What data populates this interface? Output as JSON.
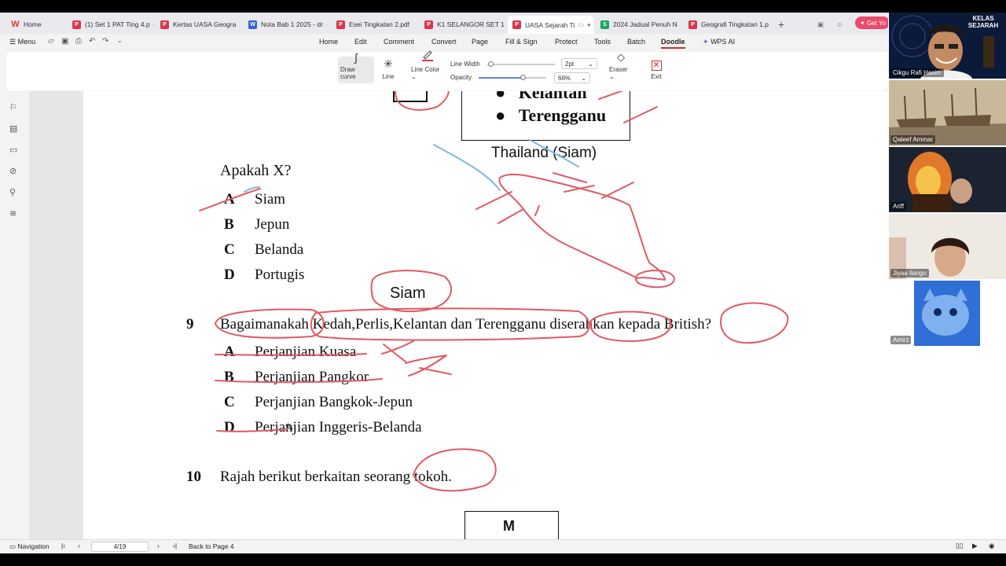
{
  "tabs": [
    {
      "label": "Home",
      "icon": "wps-logo-icon",
      "kind": "wps"
    },
    {
      "label": "(1) Set 1 PAT Ting 4.p",
      "icon": "pdf-icon",
      "kind": "pdf"
    },
    {
      "label": "Kertas UASA Geogra",
      "icon": "pdf-icon",
      "kind": "pdf"
    },
    {
      "label": "Nota Bab 1 2025 - dr",
      "icon": "word-icon",
      "kind": "word"
    },
    {
      "label": "Esei Tingkatan 2.pdf",
      "icon": "pdf-icon",
      "kind": "pdf"
    },
    {
      "label": "K1 SELANGOR SET 1",
      "icon": "pdf-icon",
      "kind": "pdf"
    },
    {
      "label": "UASA Sejarah Ti",
      "icon": "pdf-icon",
      "kind": "pdf"
    },
    {
      "label": "2024 Jadual Penuh N",
      "icon": "sheet-icon",
      "kind": "sheet"
    },
    {
      "label": "Geografi Tingkatan 1.p",
      "icon": "pdf-icon",
      "kind": "pdf"
    }
  ],
  "getbutton": "Get Yo",
  "menu": {
    "menu_label": "Menu",
    "items": [
      "Home",
      "Edit",
      "Comment",
      "Convert",
      "Page",
      "Fill & Sign",
      "Protect",
      "Tools",
      "Batch",
      "Doodle"
    ],
    "wps_ai": "WPS AI"
  },
  "toolbar": {
    "draw_curve": "Draw curve",
    "line": "Line",
    "line_color": "Line Color",
    "line_width_label": "Line Width",
    "line_width_value": "2pt",
    "opacity_label": "Opacity",
    "opacity_value": "66%",
    "opacity_level": 0.66,
    "eraser": "Eraser",
    "exit": "Exit",
    "line_color_hex": "#d9364e"
  },
  "document": {
    "box_items": [
      "Kelantan",
      "Terengganu"
    ],
    "map_label": "Thailand (Siam)",
    "q8_stem": "Apakah X?",
    "q8_options": [
      {
        "letter": "A",
        "text": "Siam"
      },
      {
        "letter": "B",
        "text": "Jepun"
      },
      {
        "letter": "C",
        "text": "Belanda"
      },
      {
        "letter": "D",
        "text": "Portugis"
      }
    ],
    "handwritten_answer": "Siam",
    "q9_number": "9",
    "q9_stem": "Bagaimanakah Kedah,Perlis,Kelantan dan Terengganu diserahkan kepada British?",
    "q9_options": [
      {
        "letter": "A",
        "text": "Perjanjian Kuasa"
      },
      {
        "letter": "B",
        "text": "Perjanjian Pangkor"
      },
      {
        "letter": "C",
        "text": "Perjanjian Bangkok-Jepun"
      },
      {
        "letter": "D",
        "text": "Perjanjian Inggeris-Belanda"
      }
    ],
    "q10_number": "10",
    "q10_stem": "Rajah berikut berkaitan seorang tokoh.",
    "q10_box_label": "M"
  },
  "participants": [
    {
      "name": "Cikgu Rafi Hasim",
      "overlay": "KELAS SEJARAH"
    },
    {
      "name": "Qaleef Ammar"
    },
    {
      "name": "Ariff"
    },
    {
      "name": "Jiyaa Ilango"
    },
    {
      "name": "Amirz"
    }
  ],
  "status": {
    "navigation": "Navigation",
    "page_value": "4/19",
    "back_to_page": "Back to Page 4"
  }
}
